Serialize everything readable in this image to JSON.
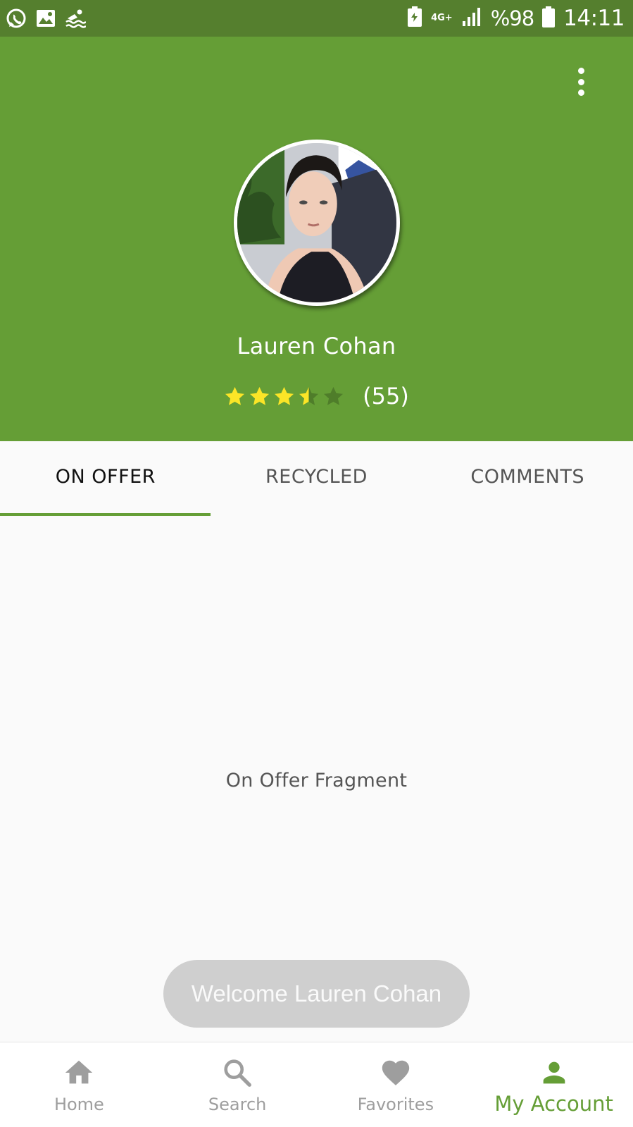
{
  "status_bar": {
    "icons_left": [
      "whatsapp-icon",
      "gallery-icon",
      "swimming-icon"
    ],
    "network": "4G+",
    "battery": "%98",
    "time": "14:11"
  },
  "header": {
    "menu_icon": "more-vertical-icon",
    "avatar": "profile-photo",
    "name": "Lauren Cohan",
    "rating": 3.5,
    "rating_max": 5,
    "rating_count": "(55)",
    "background_color": "#659e36"
  },
  "tabs": [
    {
      "label": "ON OFFER",
      "active": true
    },
    {
      "label": "RECYCLED",
      "active": false
    },
    {
      "label": "COMMENTS",
      "active": false
    }
  ],
  "content": {
    "fragment_text": "On Offer Fragment"
  },
  "toast": {
    "text": "Welcome Lauren Cohan"
  },
  "bottom_nav": [
    {
      "label": "Home",
      "icon": "home-icon",
      "active": false
    },
    {
      "label": "Search",
      "icon": "search-icon",
      "active": false
    },
    {
      "label": "Favorites",
      "icon": "heart-icon",
      "active": false
    },
    {
      "label": "My Account",
      "icon": "person-icon",
      "active": true
    }
  ],
  "colors": {
    "accent": "#659e36",
    "status_bar": "#557f2e",
    "star_filled": "#fbe527",
    "star_empty": "#4f7d2a",
    "inactive": "#9e9e9e"
  }
}
